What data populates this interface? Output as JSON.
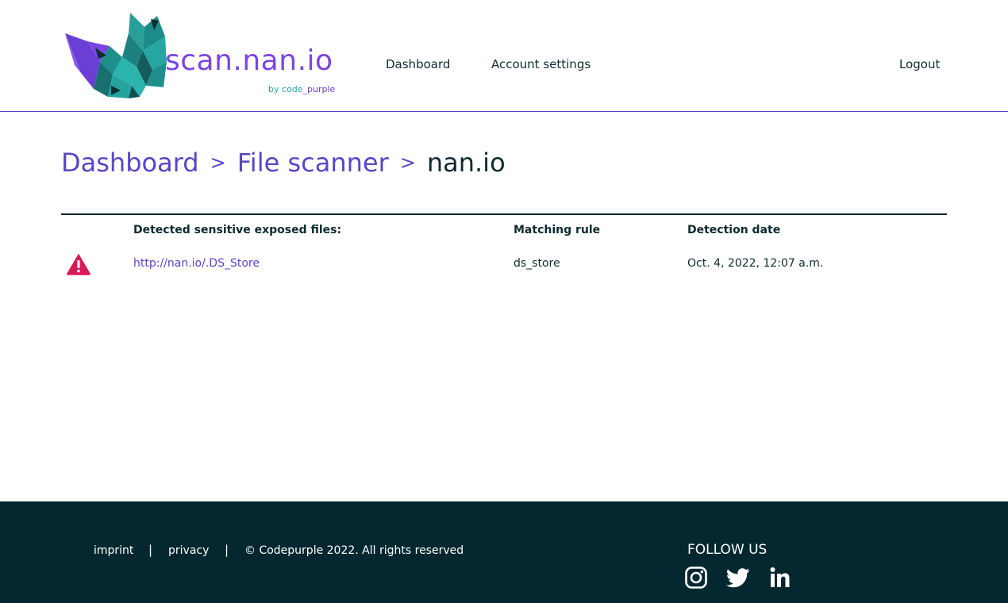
{
  "brand": {
    "name": "scan.nan.io",
    "by_prefix": "by code",
    "by_suffix": "_purple"
  },
  "nav": {
    "dashboard": "Dashboard",
    "account_settings": "Account settings",
    "logout": "Logout"
  },
  "breadcrumb": {
    "items": [
      "Dashboard",
      "File scanner"
    ],
    "separator": ">",
    "current": "nan.io"
  },
  "table": {
    "headers": [
      "Detected sensitive exposed files:",
      "Matching rule",
      "Detection date"
    ],
    "rows": [
      {
        "status_icon": "warning-triangle-icon",
        "file": "http://nan.io/.DS_Store",
        "rule": "ds_store",
        "date": "Oct. 4, 2022, 12:07 a.m."
      }
    ]
  },
  "footer": {
    "imprint": "imprint",
    "privacy": "privacy",
    "separator": "|",
    "copyright": "© Codepurple 2022. All rights reserved",
    "follow_us": "FOLLOW US",
    "social_icons": [
      "instagram-icon",
      "twitter-icon",
      "linkedin-icon"
    ]
  },
  "colors": {
    "accent": "#5b45c7",
    "brand_purple": "#7b45e0",
    "teal": "#26a6a2",
    "dark": "#0d2a30",
    "footer_bg": "#052830",
    "warning": "#d81b56"
  }
}
